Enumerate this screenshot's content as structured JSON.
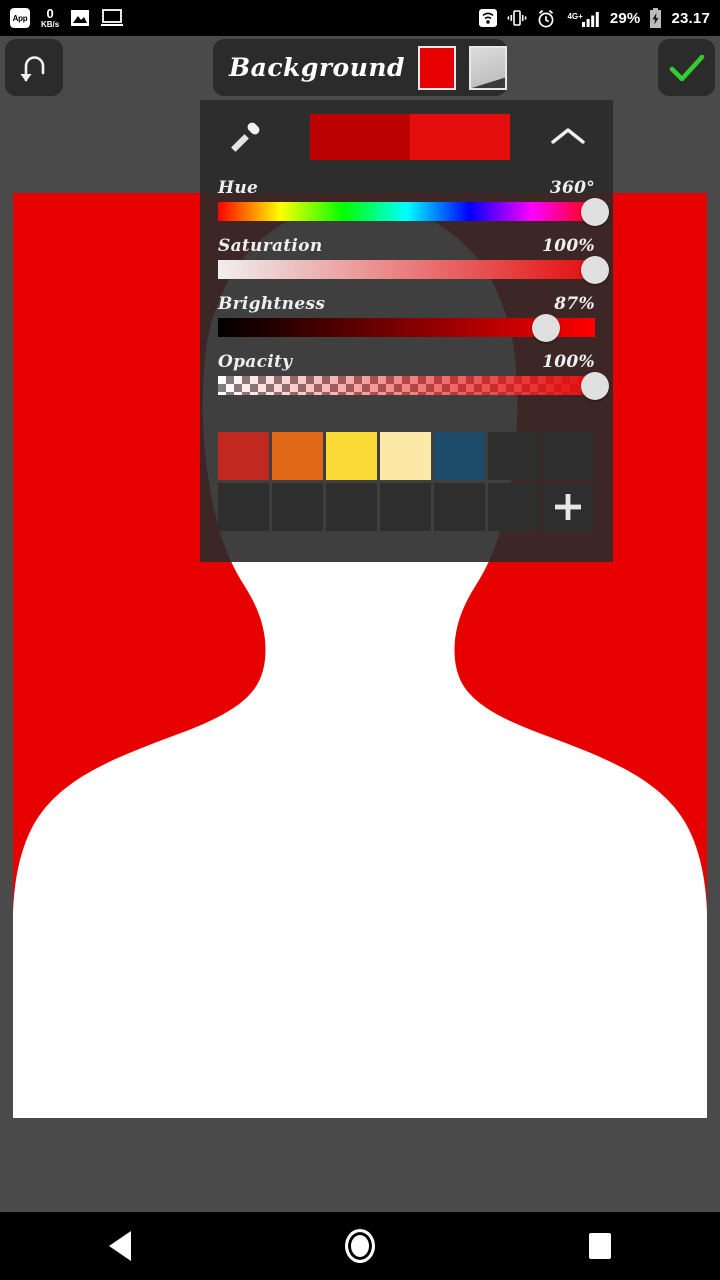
{
  "status_bar": {
    "left_icons": [
      "app-badge-icon",
      "data-speed-icon",
      "gallery-icon",
      "screencast-icon"
    ],
    "app_badge_label": "App",
    "data_speed_value": "0",
    "data_speed_unit": "KB/s",
    "right_icons": [
      "wifi-icon",
      "vibrate-icon",
      "alarm-icon",
      "signal-icon",
      "battery-charging-icon"
    ],
    "network_type": "4G+",
    "battery_percent": "29%",
    "clock": "23.17"
  },
  "toolbar": {
    "undo_icon": "undo-icon",
    "title": "Background",
    "color_swatch": "#E60000",
    "gradient_swatch": "#CFCFCF",
    "done_icon": "check-icon",
    "done_color": "#33CC33"
  },
  "color_panel": {
    "eyedropper_icon": "eyedropper-icon",
    "collapse_icon": "chevron-up-icon",
    "previous_color": "#BB0000",
    "current_color": "#E40D0D",
    "sliders": [
      {
        "name": "Hue",
        "value": "360°",
        "fill": 1.0
      },
      {
        "name": "Saturation",
        "value": "100%",
        "fill": 1.0
      },
      {
        "name": "Brightness",
        "value": "87%",
        "fill": 0.87
      },
      {
        "name": "Opacity",
        "value": "100%",
        "fill": 1.0
      }
    ],
    "palette": {
      "add_label": "+",
      "row1": [
        "#C1281F",
        "#E06A18",
        "#FADB35",
        "#FCE9A8",
        "#1B4B68",
        "",
        ""
      ],
      "row2": [
        "",
        "",
        "",
        "",
        "",
        "",
        "add"
      ]
    }
  },
  "canvas": {
    "background_color": "#E60000",
    "silhouette_color": "#FFFFFF",
    "artwork_name": "head-and-shoulders-silhouette"
  },
  "nav_bar": {
    "back_label": "back-icon",
    "home_label": "home-icon",
    "recents_label": "recents-icon"
  }
}
